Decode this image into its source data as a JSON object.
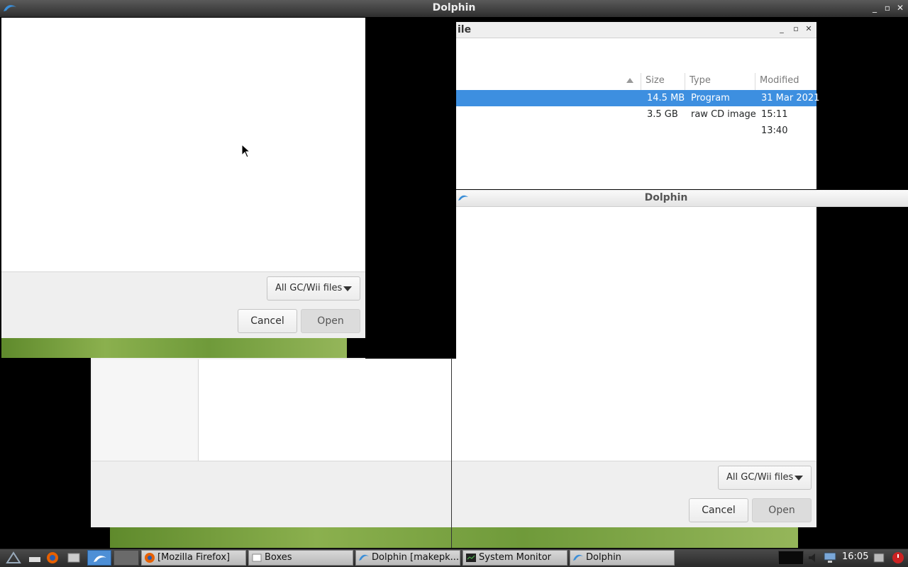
{
  "topbar": {
    "title": "Dolphin",
    "buttons": [
      "_",
      "▫",
      "✕"
    ]
  },
  "right_dialog": {
    "title_partial": "ile",
    "window_buttons": [
      "_",
      "▫",
      "✕"
    ],
    "columns": [
      "Size",
      "Type",
      "Modified"
    ],
    "rows": [
      {
        "size": "14.5 MB",
        "type": "Program",
        "modified": "31 Mar 2021",
        "selected": true
      },
      {
        "size": "3.5 GB",
        "type": "raw CD image",
        "modified": "15:11",
        "selected": false
      },
      {
        "size": "",
        "type": "",
        "modified": "13:40",
        "selected": false
      }
    ]
  },
  "dolphin_bar": {
    "title": "Dolphin"
  },
  "front_dialog": {
    "filter": "All GC/Wii files",
    "cancel": "Cancel",
    "open": "Open"
  },
  "back_dialog": {
    "filter": "All GC/Wii files",
    "cancel": "Cancel",
    "open": "Open"
  },
  "taskbar": {
    "tasks": [
      {
        "label": "[Mozilla Firefox]",
        "icon": "firefox-icon"
      },
      {
        "label": "Boxes",
        "icon": "boxes-icon"
      },
      {
        "label": "Dolphin [makepk...",
        "icon": "dolphin-icon"
      },
      {
        "label": "System Monitor",
        "icon": "system-monitor-icon"
      },
      {
        "label": "Dolphin",
        "icon": "dolphin-icon"
      }
    ],
    "clock": "16:05"
  },
  "colors": {
    "selection": "#3d8fe0",
    "wallpaper": "#7aa43e"
  }
}
